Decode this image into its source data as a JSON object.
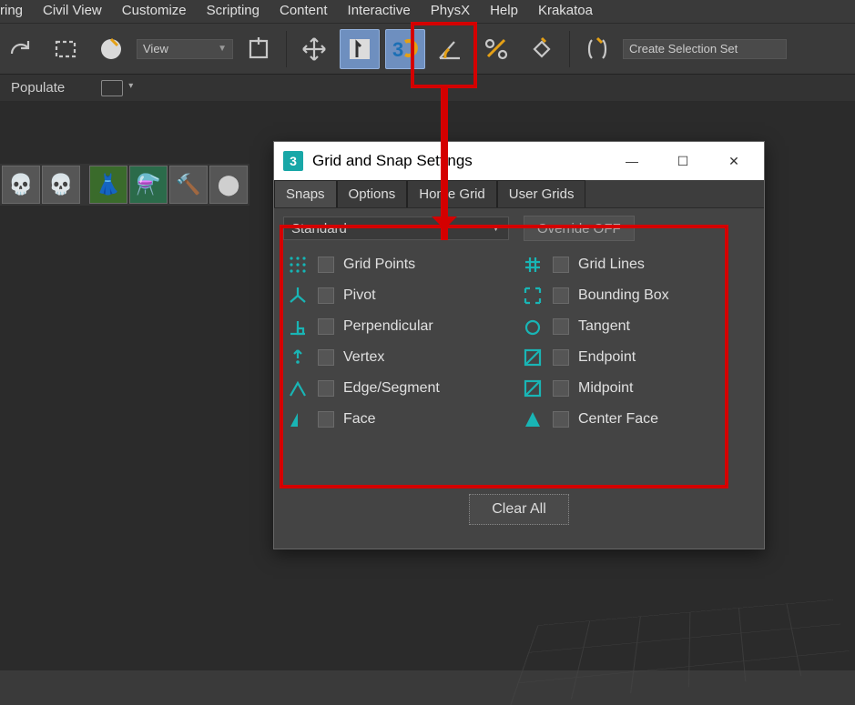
{
  "menubar": [
    "ring",
    "Civil View",
    "Customize",
    "Scripting",
    "Content",
    "Interactive",
    "PhysX",
    "Help",
    "Krakatoa"
  ],
  "toolbar": {
    "view_label": "View",
    "selset_label": "Create Selection Set"
  },
  "secondbar": {
    "label": "Populate"
  },
  "dialog": {
    "title": "Grid and Snap Settings",
    "tabs": [
      "Snaps",
      "Options",
      "Home Grid",
      "User Grids"
    ],
    "active_tab": 0,
    "standard_label": "Standard",
    "override_label": "Override OFF",
    "clear_all": "Clear All",
    "snaps_left": [
      {
        "label": "Grid Points"
      },
      {
        "label": "Pivot"
      },
      {
        "label": "Perpendicular"
      },
      {
        "label": "Vertex"
      },
      {
        "label": "Edge/Segment"
      },
      {
        "label": "Face"
      }
    ],
    "snaps_right": [
      {
        "label": "Grid Lines"
      },
      {
        "label": "Bounding Box"
      },
      {
        "label": "Tangent"
      },
      {
        "label": "Endpoint"
      },
      {
        "label": "Midpoint"
      },
      {
        "label": "Center Face"
      }
    ]
  }
}
